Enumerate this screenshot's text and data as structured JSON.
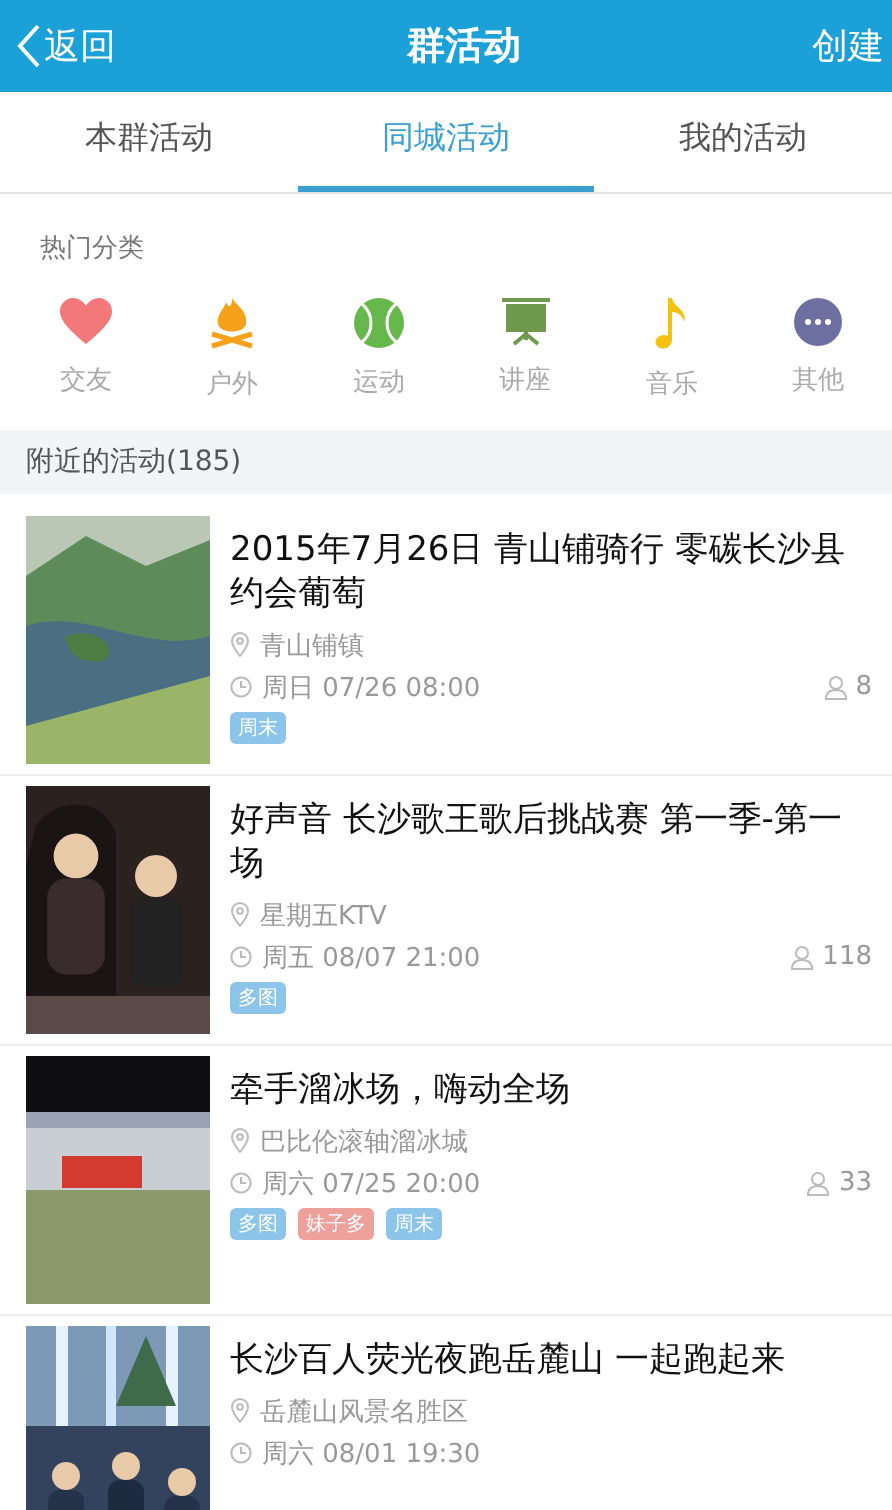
{
  "nav_bar": {
    "back": "返回",
    "title": "群活动",
    "action": "创建"
  },
  "tabs": [
    {
      "label": "本群活动",
      "selected": false
    },
    {
      "label": "同城活动",
      "selected": true
    },
    {
      "label": "我的活动",
      "selected": false
    }
  ],
  "hot_categories": {
    "heading": "热门分类",
    "items": [
      {
        "kind": "heart",
        "label": "交友"
      },
      {
        "kind": "fire",
        "label": "户外"
      },
      {
        "kind": "ball",
        "label": "运动"
      },
      {
        "kind": "board",
        "label": "讲座"
      },
      {
        "kind": "note",
        "label": "音乐"
      },
      {
        "kind": "more",
        "label": "其他"
      }
    ]
  },
  "nearby": {
    "heading": "附近的活动(185)",
    "events": [
      {
        "photo": {
          "kind": "picture"
        },
        "title": "2015年7月26日 青山铺骑行  零碳长沙县约会葡萄",
        "location": "青山铺镇",
        "time": "周日 07/26 08:00",
        "count": "8",
        "tags": [
          {
            "label": "周末",
            "color": "#8cc4ea"
          }
        ]
      },
      {
        "photo": {
          "kind": "picture"
        },
        "title": "好声音 长沙歌王歌后挑战赛  第一季-第一场",
        "location": "星期五KTV",
        "time": "周五 08/07 21:00",
        "count": "118",
        "tags": [
          {
            "label": "多图",
            "color": "#8cc4ea"
          }
        ]
      },
      {
        "photo": {
          "kind": "picture"
        },
        "title": "牵手溜冰场，嗨动全场",
        "location": "巴比伦滚轴溜冰城",
        "time": "周六 07/25 20:00",
        "count": "33",
        "tags": [
          {
            "label": "多图",
            "color": "#8cc4ea"
          },
          {
            "label": "妹子多",
            "color": "#eea19a"
          },
          {
            "label": "周末",
            "color": "#8cc4ea"
          }
        ]
      },
      {
        "photo": {
          "kind": "picture"
        },
        "title": "长沙百人荧光夜跑岳麓山 一起跑起来",
        "location": "岳麓山风景名胜区",
        "time": "周六 08/01 19:30"
      }
    ]
  }
}
